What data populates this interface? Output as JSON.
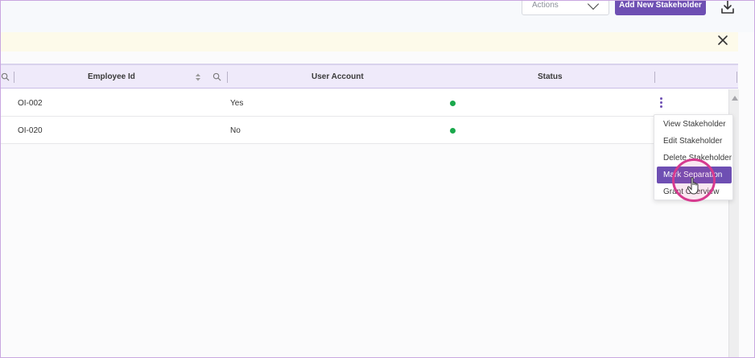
{
  "toolbar": {
    "actions_label": "Actions",
    "add_label": "Add New Stakeholder"
  },
  "table": {
    "columns": [
      "Employee Id",
      "User Account",
      "Status"
    ],
    "rows": [
      {
        "employee_id": "OI-002",
        "user_account": "Yes",
        "status_color": "#1aa84c"
      },
      {
        "employee_id": "OI-020",
        "user_account": "No",
        "status_color": "#1aa84c"
      }
    ]
  },
  "row_menu": {
    "items": [
      "View Stakeholder",
      "Edit Stakeholder",
      "Delete Stakeholder",
      "Mark Separation",
      "Grant Overview"
    ],
    "active_index": 3
  },
  "colors": {
    "accent": "#6e4fb3",
    "header_bg": "#efeafa",
    "banner_bg": "#fdfaea",
    "cursor_highlight": "#d63a8f"
  }
}
